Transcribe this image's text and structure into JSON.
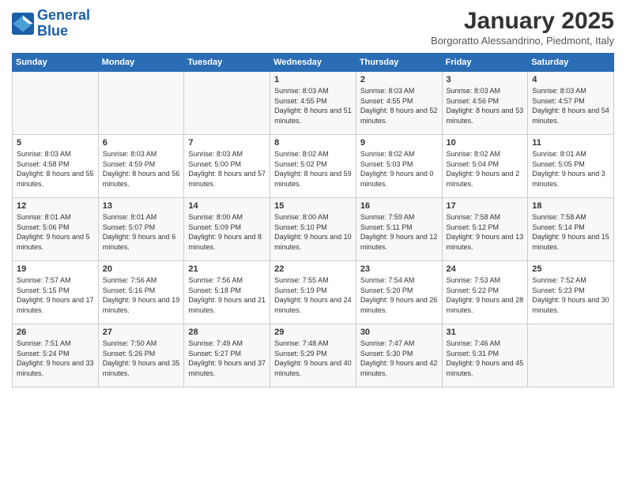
{
  "logo": {
    "line1": "General",
    "line2": "Blue"
  },
  "title": "January 2025",
  "location": "Borgoratto Alessandrino, Piedmont, Italy",
  "days_of_week": [
    "Sunday",
    "Monday",
    "Tuesday",
    "Wednesday",
    "Thursday",
    "Friday",
    "Saturday"
  ],
  "weeks": [
    [
      {
        "day": "",
        "info": ""
      },
      {
        "day": "",
        "info": ""
      },
      {
        "day": "",
        "info": ""
      },
      {
        "day": "1",
        "info": "Sunrise: 8:03 AM\nSunset: 4:55 PM\nDaylight: 8 hours\nand 51 minutes."
      },
      {
        "day": "2",
        "info": "Sunrise: 8:03 AM\nSunset: 4:55 PM\nDaylight: 8 hours\nand 52 minutes."
      },
      {
        "day": "3",
        "info": "Sunrise: 8:03 AM\nSunset: 4:56 PM\nDaylight: 8 hours\nand 53 minutes."
      },
      {
        "day": "4",
        "info": "Sunrise: 8:03 AM\nSunset: 4:57 PM\nDaylight: 8 hours\nand 54 minutes."
      }
    ],
    [
      {
        "day": "5",
        "info": "Sunrise: 8:03 AM\nSunset: 4:58 PM\nDaylight: 8 hours\nand 55 minutes."
      },
      {
        "day": "6",
        "info": "Sunrise: 8:03 AM\nSunset: 4:59 PM\nDaylight: 8 hours\nand 56 minutes."
      },
      {
        "day": "7",
        "info": "Sunrise: 8:03 AM\nSunset: 5:00 PM\nDaylight: 8 hours\nand 57 minutes."
      },
      {
        "day": "8",
        "info": "Sunrise: 8:02 AM\nSunset: 5:02 PM\nDaylight: 8 hours\nand 59 minutes."
      },
      {
        "day": "9",
        "info": "Sunrise: 8:02 AM\nSunset: 5:03 PM\nDaylight: 9 hours\nand 0 minutes."
      },
      {
        "day": "10",
        "info": "Sunrise: 8:02 AM\nSunset: 5:04 PM\nDaylight: 9 hours\nand 2 minutes."
      },
      {
        "day": "11",
        "info": "Sunrise: 8:01 AM\nSunset: 5:05 PM\nDaylight: 9 hours\nand 3 minutes."
      }
    ],
    [
      {
        "day": "12",
        "info": "Sunrise: 8:01 AM\nSunset: 5:06 PM\nDaylight: 9 hours\nand 5 minutes."
      },
      {
        "day": "13",
        "info": "Sunrise: 8:01 AM\nSunset: 5:07 PM\nDaylight: 9 hours\nand 6 minutes."
      },
      {
        "day": "14",
        "info": "Sunrise: 8:00 AM\nSunset: 5:09 PM\nDaylight: 9 hours\nand 8 minutes."
      },
      {
        "day": "15",
        "info": "Sunrise: 8:00 AM\nSunset: 5:10 PM\nDaylight: 9 hours\nand 10 minutes."
      },
      {
        "day": "16",
        "info": "Sunrise: 7:59 AM\nSunset: 5:11 PM\nDaylight: 9 hours\nand 12 minutes."
      },
      {
        "day": "17",
        "info": "Sunrise: 7:58 AM\nSunset: 5:12 PM\nDaylight: 9 hours\nand 13 minutes."
      },
      {
        "day": "18",
        "info": "Sunrise: 7:58 AM\nSunset: 5:14 PM\nDaylight: 9 hours\nand 15 minutes."
      }
    ],
    [
      {
        "day": "19",
        "info": "Sunrise: 7:57 AM\nSunset: 5:15 PM\nDaylight: 9 hours\nand 17 minutes."
      },
      {
        "day": "20",
        "info": "Sunrise: 7:56 AM\nSunset: 5:16 PM\nDaylight: 9 hours\nand 19 minutes."
      },
      {
        "day": "21",
        "info": "Sunrise: 7:56 AM\nSunset: 5:18 PM\nDaylight: 9 hours\nand 21 minutes."
      },
      {
        "day": "22",
        "info": "Sunrise: 7:55 AM\nSunset: 5:19 PM\nDaylight: 9 hours\nand 24 minutes."
      },
      {
        "day": "23",
        "info": "Sunrise: 7:54 AM\nSunset: 5:20 PM\nDaylight: 9 hours\nand 26 minutes."
      },
      {
        "day": "24",
        "info": "Sunrise: 7:53 AM\nSunset: 5:22 PM\nDaylight: 9 hours\nand 28 minutes."
      },
      {
        "day": "25",
        "info": "Sunrise: 7:52 AM\nSunset: 5:23 PM\nDaylight: 9 hours\nand 30 minutes."
      }
    ],
    [
      {
        "day": "26",
        "info": "Sunrise: 7:51 AM\nSunset: 5:24 PM\nDaylight: 9 hours\nand 33 minutes."
      },
      {
        "day": "27",
        "info": "Sunrise: 7:50 AM\nSunset: 5:26 PM\nDaylight: 9 hours\nand 35 minutes."
      },
      {
        "day": "28",
        "info": "Sunrise: 7:49 AM\nSunset: 5:27 PM\nDaylight: 9 hours\nand 37 minutes."
      },
      {
        "day": "29",
        "info": "Sunrise: 7:48 AM\nSunset: 5:29 PM\nDaylight: 9 hours\nand 40 minutes."
      },
      {
        "day": "30",
        "info": "Sunrise: 7:47 AM\nSunset: 5:30 PM\nDaylight: 9 hours\nand 42 minutes."
      },
      {
        "day": "31",
        "info": "Sunrise: 7:46 AM\nSunset: 5:31 PM\nDaylight: 9 hours\nand 45 minutes."
      },
      {
        "day": "",
        "info": ""
      }
    ]
  ]
}
